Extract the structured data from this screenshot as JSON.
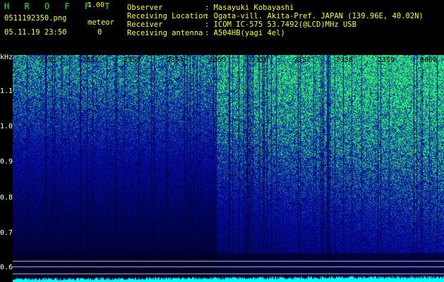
{
  "header": {
    "brand": "H R O F F T",
    "version": "1.00",
    "filename": "0511192350.png",
    "meteor_label": "meteor",
    "datetime": "05.11.19 23:50",
    "meteor_count": "0",
    "observer_label": "Observer",
    "observer_value": ": Masayuki Kobayashi",
    "location_label": "Receiving Location",
    "location_value": ": Ogata-vill. Akita-Pref. JAPAN (139.96E, 40.02N)",
    "receiver_label": "Receiver",
    "receiver_value": ": ICOM IC-575 53.7492(@LCD)MHz USB",
    "antenna_label": "Receiving antenna",
    "antenna_value": ": A504HB(yagi 4el)"
  },
  "axis": {
    "y_unit": "kHz",
    "y_ticks": [
      "1.1",
      "1.0",
      "0.9",
      "0.8",
      "0.7",
      "0.6"
    ],
    "x_ticks": [
      "2351",
      "2352",
      "2353",
      "2354",
      "2355",
      "2356",
      "2357",
      "2358",
      "2359",
      "0000"
    ]
  },
  "colors": {
    "background": "#000000",
    "brand": "#00ff00",
    "label": "#ffff00",
    "text": "#ffffff",
    "spectrum_low": "#0a1aa0",
    "spectrum_high": "#30ff70",
    "baseline": "#00ffff"
  }
}
